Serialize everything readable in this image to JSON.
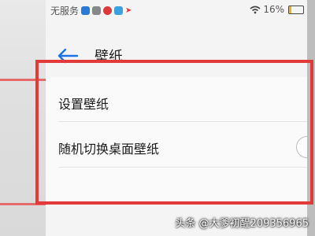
{
  "status_bar": {
    "carrier": "无服务",
    "battery_percent": "16%",
    "battery_level": 0.16
  },
  "header": {
    "title": "壁纸"
  },
  "settings": {
    "set_wallpaper": "设置壁纸",
    "random_switch_label": "随机切换桌面壁纸",
    "random_switch_on": false
  },
  "watermark": "头条 @大爹初醒209356965",
  "colors": {
    "highlight": "#e23a3a",
    "accent_blue": "#1a73e8"
  }
}
